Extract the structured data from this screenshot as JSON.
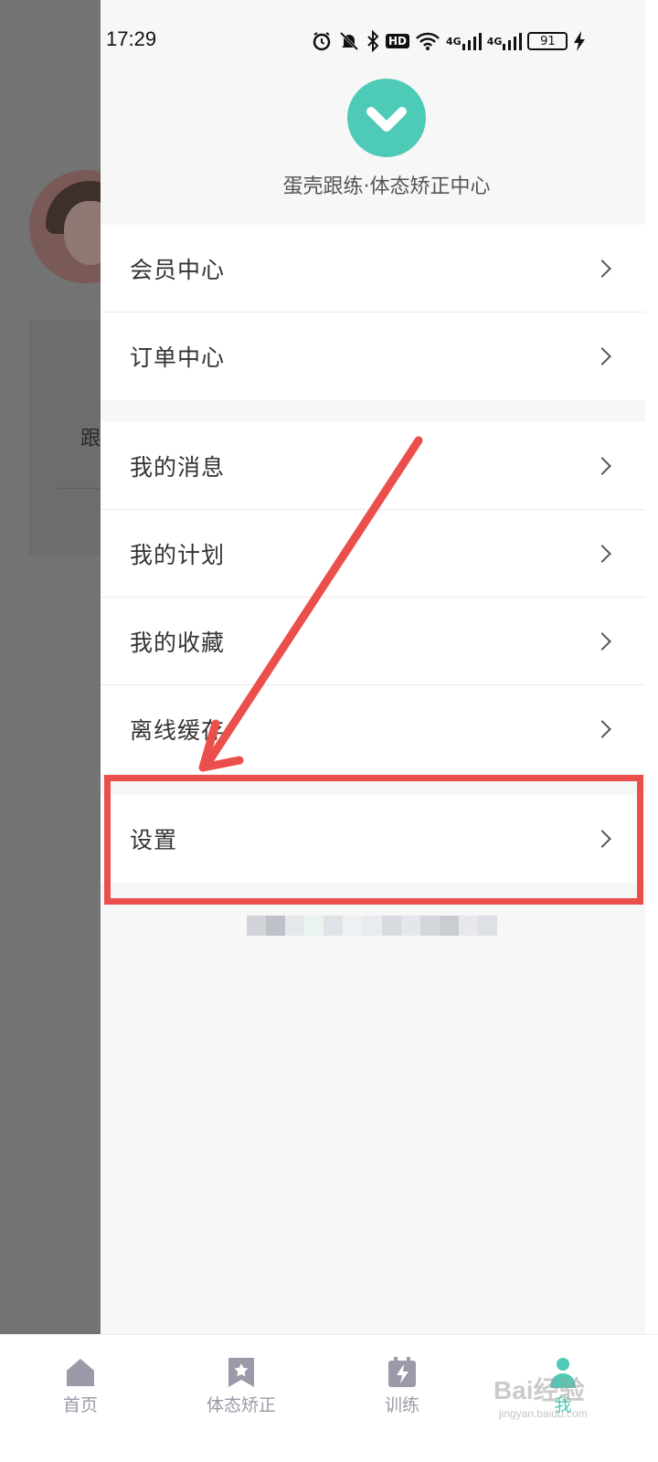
{
  "status_bar": {
    "time": "17:29",
    "network_1": "4G",
    "network_2": "4G",
    "hd_badge": "HD",
    "battery": "91",
    "icons": [
      "alarm-icon",
      "mute-bell-icon",
      "bluetooth-icon",
      "hd-icon",
      "wifi-icon",
      "signal-icon",
      "signal-icon",
      "battery-icon",
      "charging-icon"
    ]
  },
  "background_page": {
    "card_text": "跟"
  },
  "drawer": {
    "brand_name": "蛋壳跟练·体态矫正中心",
    "logo_color": "#4ecbb6",
    "groups": [
      {
        "items": [
          {
            "label": "会员中心"
          },
          {
            "label": "订单中心"
          }
        ]
      },
      {
        "items": [
          {
            "label": "我的消息"
          },
          {
            "label": "我的计划"
          },
          {
            "label": "我的收藏"
          },
          {
            "label": "离线缓存"
          }
        ]
      },
      {
        "items": [
          {
            "label": "设置"
          }
        ]
      }
    ]
  },
  "annotation": {
    "color": "#eb4f4c"
  },
  "tab_bar": {
    "tabs": [
      {
        "label": "首页",
        "icon": "home-icon",
        "active": false
      },
      {
        "label": "体态矫正",
        "icon": "bookmark-star-icon",
        "active": false
      },
      {
        "label": "训练",
        "icon": "calendar-bolt-icon",
        "active": false
      },
      {
        "label": "我",
        "icon": "person-icon",
        "active": true
      }
    ],
    "active_color": "#4ecbb6",
    "inactive_color": "#9a9aa8"
  },
  "watermark": {
    "text": "Bai经验",
    "url": "jingyan.baidu.com"
  }
}
